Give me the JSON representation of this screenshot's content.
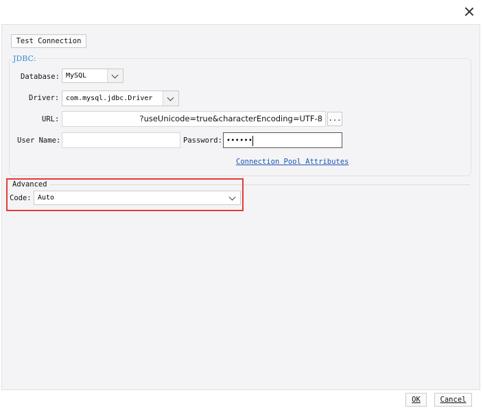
{
  "window": {
    "close_label": "×"
  },
  "toolbar": {
    "test_connection_label": "Test Connection"
  },
  "jdbc": {
    "legend": "JDBC:",
    "database_label": "Database:",
    "database_value": "MySQL",
    "driver_label": "Driver:",
    "driver_value": "com.mysql.jdbc.Driver",
    "url_label": "URL:",
    "url_value": "?useUnicode=true&characterEncoding=UTF-8",
    "url_browse_label": "...",
    "username_label": "User Name:",
    "username_value": "",
    "password_label": "Password:",
    "password_value": "••••••",
    "pool_link": "Connection Pool Attributes"
  },
  "advanced": {
    "legend": "Advanced",
    "code_label": "Code:",
    "code_value": "Auto"
  },
  "footer": {
    "ok_label": "OK",
    "cancel_label": "Cancel"
  },
  "colors": {
    "highlight": "#e53935",
    "legend": "#3a8bd0",
    "link": "#1a55b5"
  }
}
